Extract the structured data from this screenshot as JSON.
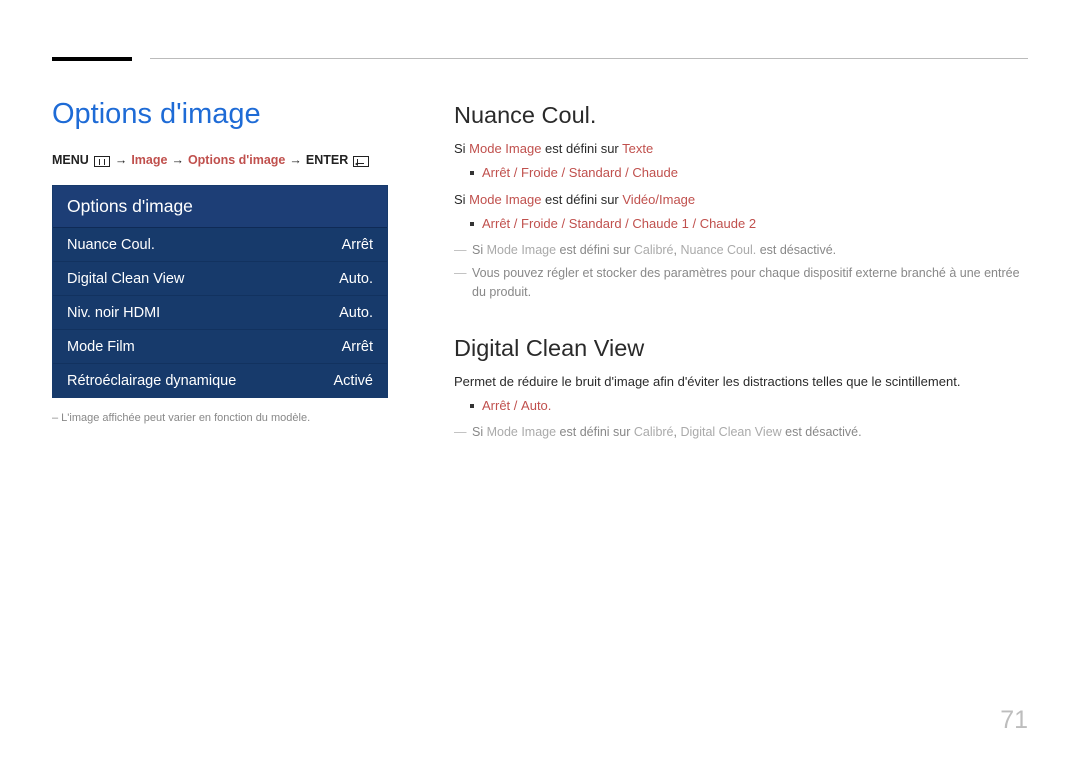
{
  "page_number": "71",
  "left": {
    "title": "Options d'image",
    "path": {
      "menu": "MENU",
      "image": "Image",
      "options": "Options d'image",
      "enter": "ENTER"
    },
    "panel": {
      "header": "Options d'image",
      "rows": [
        {
          "label": "Nuance Coul.",
          "value": "Arrêt"
        },
        {
          "label": "Digital Clean View",
          "value": "Auto."
        },
        {
          "label": "Niv. noir HDMI",
          "value": "Auto."
        },
        {
          "label": "Mode Film",
          "value": "Arrêt"
        },
        {
          "label": "Rétroéclairage dynamique",
          "value": "Activé"
        }
      ]
    },
    "footnote": "– L'image affichée peut varier en fonction du modèle."
  },
  "right": {
    "nuance": {
      "title": "Nuance Coul.",
      "line1_pre": "Si ",
      "line1_kw1": "Mode Image",
      "line1_mid": " est défini sur ",
      "line1_kw2": "Texte",
      "opts1": [
        "Arrêt",
        "Froide",
        "Standard",
        "Chaude"
      ],
      "line2_pre": "Si ",
      "line2_kw1": "Mode Image",
      "line2_mid": " est défini sur ",
      "line2_kw2": "Vidéo/Image",
      "opts2": [
        "Arrêt",
        "Froide",
        "Standard",
        "Chaude 1",
        "Chaude 2"
      ],
      "note1_pre": "Si ",
      "note1_kw1": "Mode Image",
      "note1_mid": " est défini sur ",
      "note1_kw2": "Calibré",
      "note1_sep": ", ",
      "note1_kw3": "Nuance Coul.",
      "note1_post": " est désactivé.",
      "note2": "Vous pouvez régler et stocker des paramètres pour chaque dispositif externe branché à une entrée du produit."
    },
    "dcv": {
      "title": "Digital Clean View",
      "desc": "Permet de réduire le bruit d'image afin d'éviter les distractions telles que le scintillement.",
      "opts": [
        "Arrêt",
        "Auto."
      ],
      "note_pre": "Si ",
      "note_kw1": "Mode Image",
      "note_mid": " est défini sur ",
      "note_kw2": "Calibré",
      "note_sep": ", ",
      "note_kw3": "Digital Clean View",
      "note_post": " est désactivé."
    }
  }
}
